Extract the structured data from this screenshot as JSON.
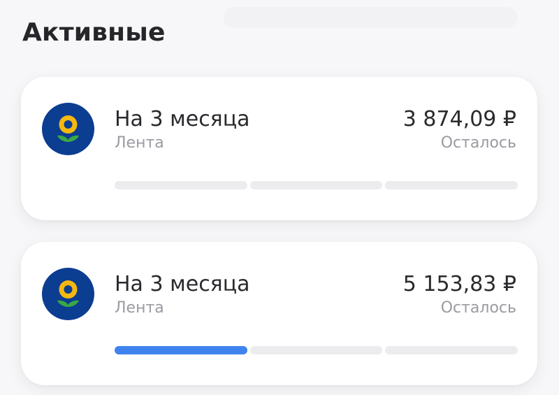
{
  "section": {
    "title": "Активные"
  },
  "colors": {
    "progress_done": "#3f84ee",
    "progress_pending": "#ececef",
    "logo_background": "#0b3d91",
    "logo_flower": "#f5b80f",
    "logo_leaves": "#3aa844"
  },
  "cards": [
    {
      "icon": "lenta-sunflower-logo",
      "plan_title": "На 3 месяца",
      "store": "Лента",
      "amount": "3 874,09 ₽",
      "amount_caption": "Осталось",
      "payments_total": 3,
      "payments_done": 0
    },
    {
      "icon": "lenta-sunflower-logo",
      "plan_title": "На 3 месяца",
      "store": "Лента",
      "amount": "5 153,83 ₽",
      "amount_caption": "Осталось",
      "payments_total": 3,
      "payments_done": 1
    }
  ]
}
